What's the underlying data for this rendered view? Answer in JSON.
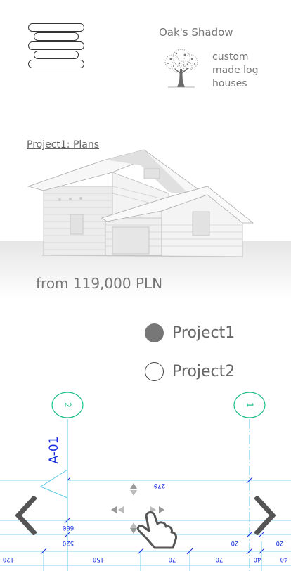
{
  "header": {
    "brand_name": "Oak's Shadow",
    "tagline": [
      "custom",
      "made log",
      "houses"
    ],
    "menu_icon": "hamburger-menu-icon",
    "logo_icon": "oak-tree-icon"
  },
  "project": {
    "link_label": "Project1: Plans",
    "price": "from 119,000 PLN"
  },
  "selector": {
    "options": [
      {
        "label": "Project1",
        "selected": true
      },
      {
        "label": "Project2",
        "selected": false
      }
    ]
  },
  "plan": {
    "axis_labels": [
      "2",
      "1"
    ],
    "section_label": "A-01",
    "dimensions": [
      "270",
      "600",
      "520",
      "20",
      "20",
      "40",
      "120",
      "150",
      "70",
      "70",
      "40"
    ]
  },
  "nav": {
    "prev_icon": "chevron-left-icon",
    "next_icon": "chevron-right-icon",
    "pan_icon": "hand-pan-icon"
  },
  "colors": {
    "accent_green": "#1bbf8a",
    "plan_blue": "#1a2ee0",
    "grid_cyan": "#5cc8e8"
  }
}
